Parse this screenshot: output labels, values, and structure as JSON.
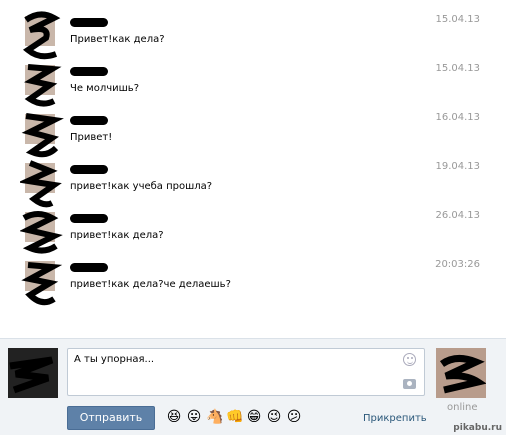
{
  "messages": [
    {
      "name": "",
      "text": "Привет!как дела?",
      "date": "15.04.13"
    },
    {
      "name": "",
      "text": "Че молчишь?",
      "date": "15.04.13"
    },
    {
      "name": "",
      "text": "Привет!",
      "date": "16.04.13"
    },
    {
      "name": "",
      "text": "привет!как учеба прошла?",
      "date": "19.04.13"
    },
    {
      "name": "",
      "text": "привет!как дела?",
      "date": "26.04.13"
    },
    {
      "name": "",
      "text": "привет!как дела?че делаешь?",
      "date": "20:03:26"
    }
  ],
  "composer": {
    "input_value": "А ты упорная...",
    "send_label": "Отправить",
    "attach_label": "Прикрепить",
    "status": "online",
    "emojis": [
      "😆",
      "😛",
      "🐴",
      "👊",
      "😁",
      "😉",
      "😕"
    ]
  },
  "watermark": "pikabu.ru",
  "colors": {
    "link": "#2b587a",
    "send_button": "#5e81a8",
    "composer_bg": "#f0f3f6"
  }
}
